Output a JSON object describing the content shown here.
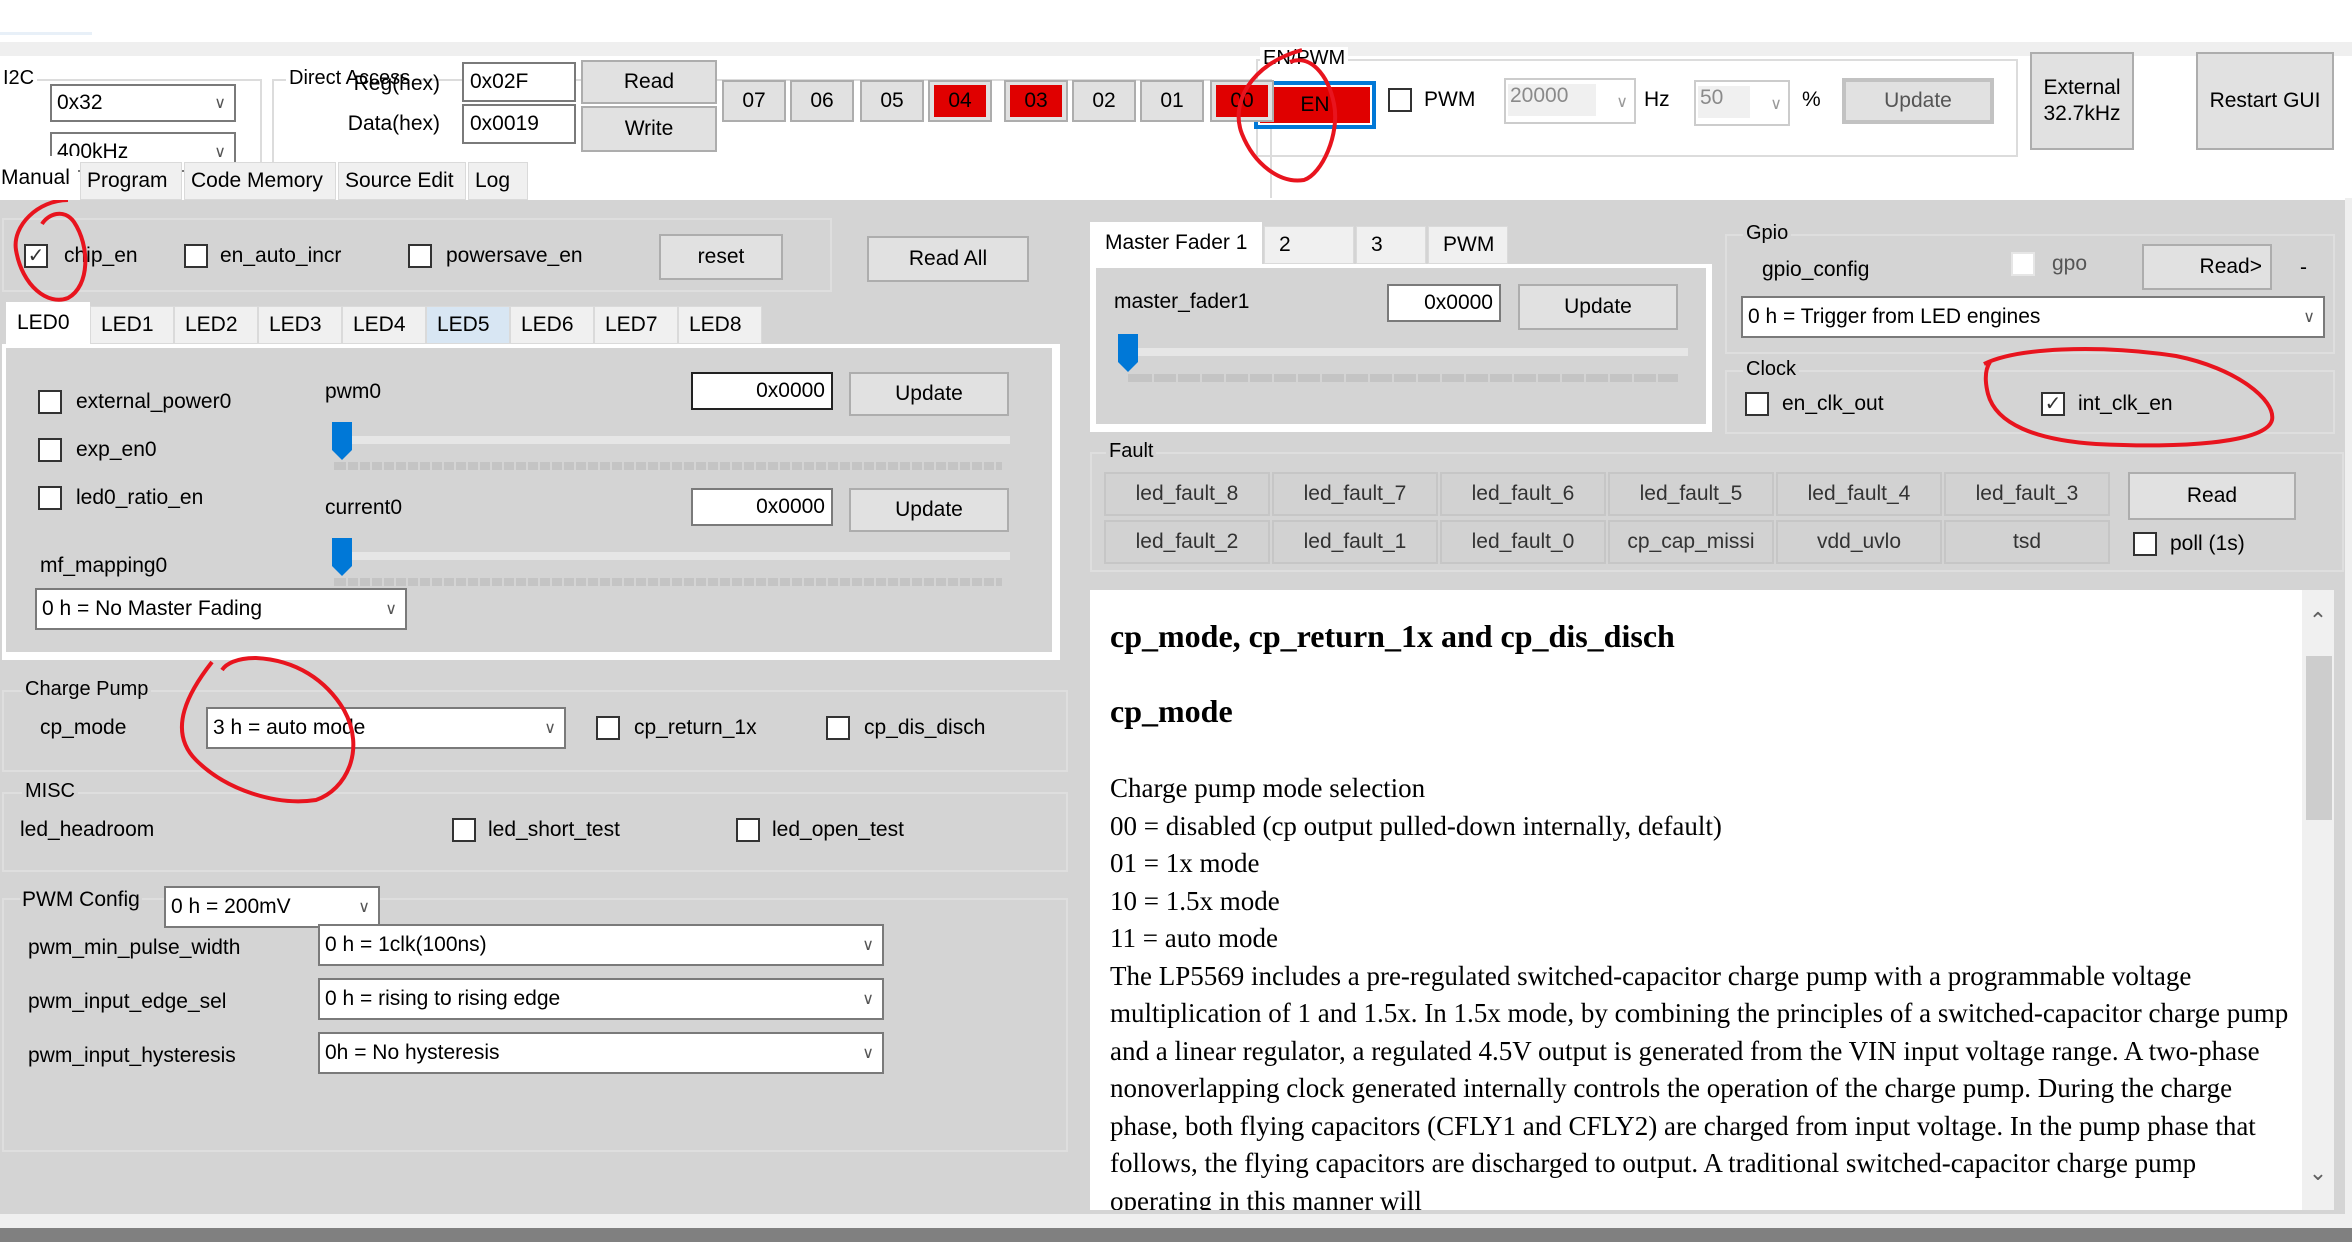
{
  "i2c": {
    "group_title": "I2C",
    "address": "0x32",
    "speed": "400kHz"
  },
  "direct_access": {
    "group_title": "Direct Access",
    "reg_label": "Reg(hex)",
    "reg_value": "0x02F",
    "data_label": "Data(hex)",
    "data_value": "0x0019",
    "read_label": "Read",
    "write_label": "Write"
  },
  "bits": [
    {
      "label": "07",
      "on": false
    },
    {
      "label": "06",
      "on": false
    },
    {
      "label": "05",
      "on": false
    },
    {
      "label": "04",
      "on": true
    },
    {
      "label": "03",
      "on": true
    },
    {
      "label": "02",
      "on": false
    },
    {
      "label": "01",
      "on": false
    },
    {
      "label": "00",
      "on": true
    }
  ],
  "en_pwm": {
    "group_title": "EN/PWM",
    "en_label": "EN",
    "pwm_label": "PWM",
    "pwm_checked": false,
    "freq_value": "20000",
    "freq_unit": "Hz",
    "duty_value": "50",
    "duty_unit": "%",
    "update_label": "Update"
  },
  "external_button": "External\n32.7kHz",
  "external_line1": "External",
  "external_line2": "32.7kHz",
  "restart_button": "Restart GUI",
  "main_tabs": [
    "Manual",
    "Program",
    "Code Memory",
    "Source Edit",
    "Log"
  ],
  "main_tab_active": "Manual",
  "control": {
    "chip_en_label": "chip_en",
    "chip_en_checked": true,
    "en_auto_incr_label": "en_auto_incr",
    "en_auto_incr_checked": false,
    "powersave_en_label": "powersave_en",
    "powersave_en_checked": false,
    "reset_label": "reset",
    "read_all_label": "Read All"
  },
  "led_tabs": [
    "LED0",
    "LED1",
    "LED2",
    "LED3",
    "LED4",
    "LED5",
    "LED6",
    "LED7",
    "LED8"
  ],
  "led_tab_active": "LED0",
  "led_tab_highlight": "LED5",
  "led0": {
    "external_power_label": "external_power0",
    "exp_en_label": "exp_en0",
    "ratio_en_label": "led0_ratio_en",
    "pwm_label": "pwm0",
    "pwm_value": "0x0000",
    "pwm_slider": 0,
    "current_label": "current0",
    "current_value": "0x0000",
    "current_slider": 0,
    "update_label": "Update",
    "mf_mapping_label": "mf_mapping0",
    "mf_mapping_value": "0 h = No Master Fading"
  },
  "charge_pump": {
    "group_title": "Charge Pump",
    "cp_mode_label": "cp_mode",
    "cp_mode_value": "3 h = auto mode",
    "cp_return_label": "cp_return_1x",
    "cp_dis_disch_label": "cp_dis_disch"
  },
  "misc": {
    "group_title": "MISC",
    "led_headroom_label": "led_headroom",
    "led_short_test_label": "led_short_test",
    "led_open_test_label": "led_open_test"
  },
  "pwm_config": {
    "group_title": "PWM Config",
    "config_value": "0 h = 200mV",
    "min_pulse_label": "pwm_min_pulse_width",
    "min_pulse_value": "0 h = 1clk(100ns)",
    "edge_sel_label": "pwm_input_edge_sel",
    "edge_sel_value": "0 h = rising to rising edge",
    "hysteresis_label": "pwm_input_hysteresis",
    "hysteresis_value": "0h = No hysteresis"
  },
  "master_fader": {
    "tabs": [
      "Master Fader 1",
      "2",
      "3",
      "PWM"
    ],
    "active": "Master Fader 1",
    "label": "master_fader1",
    "value": "0x0000",
    "slider": 0,
    "update_label": "Update"
  },
  "gpio": {
    "group_title": "Gpio",
    "config_label": "gpio_config",
    "gpo_label": "gpo",
    "read_label": "Read>",
    "read_result": "-",
    "config_value": "0 h = Trigger from LED engines"
  },
  "clock": {
    "group_title": "Clock",
    "en_clk_out_label": "en_clk_out",
    "en_clk_out_checked": false,
    "int_clk_en_label": "int_clk_en",
    "int_clk_en_checked": true
  },
  "fault": {
    "group_title": "Fault",
    "row1": [
      "led_fault_8",
      "led_fault_7",
      "led_fault_6",
      "led_fault_5",
      "led_fault_4",
      "led_fault_3"
    ],
    "row2": [
      "led_fault_2",
      "led_fault_1",
      "led_fault_0",
      "cp_cap_missi",
      "vdd_uvlo",
      "tsd"
    ],
    "read_label": "Read",
    "poll_label": "poll (1s)"
  },
  "help": {
    "title": "cp_mode, cp_return_1x and cp_dis_disch",
    "subtitle": "cp_mode",
    "lines": [
      "Charge pump mode selection",
      "00 = disabled (cp output pulled-down internally, default)",
      "01 = 1x mode",
      "10 = 1.5x mode",
      "11 = auto mode"
    ],
    "paragraph": "The LP5569 includes a pre-regulated switched-capacitor charge pump with a programmable voltage multiplication of 1 and 1.5x. In 1.5x mode, by combining the principles of a switched-capacitor charge pump and a linear regulator, a regulated 4.5V output is generated from the VIN input voltage range. A two-phase nonoverlapping clock generated internally controls the operation of the charge pump. During the charge phase, both flying capacitors (CFLY1 and CFLY2) are charged from input voltage. In the pump phase that follows, the flying capacitors are discharged to output. A traditional switched-capacitor charge pump operating in this manner will"
  },
  "colors": {
    "bit_on": "#e00000",
    "accent": "#0078d7",
    "panel_bg": "#d4d4d4",
    "annotation": "#e8141e"
  }
}
